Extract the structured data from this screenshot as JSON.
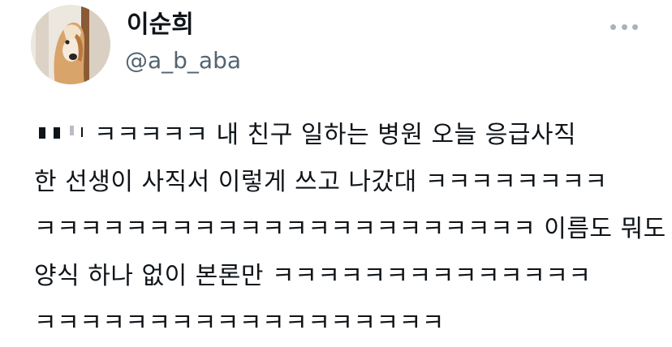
{
  "tweet": {
    "author": {
      "name": "이순희",
      "handle": "@a_b_aba"
    },
    "more_icon": "more-horizontal-icon",
    "body_lines": [
      "ㅋㅋㅋㅋㅋ 내 친구 일하는 병원 오늘 응급사직",
      "한 선생이 사직서 이렇게 쓰고 나갔대 ㅋㅋㅋㅋㅋㅋㅋㅋ",
      "ㅋㅋㅋㅋㅋㅋㅋㅋㅋㅋㅋㅋㅋㅋㅋㅋㅋㅋㅋㅋㅋㅋ 이름도 뭐도",
      "양식 하나 없이 본론만 ㅋㅋㅋㅋㅋㅋㅋㅋㅋㅋㅋㅋㅋㅋ",
      "ㅋㅋㅋㅋㅋㅋㅋㅋㅋㅋㅋㅋㅋㅋㅋㅋㅋㅋ"
    ]
  },
  "colors": {
    "text": "#0f1419",
    "secondary_text": "#536471",
    "more_dots": "#a7b3bc",
    "background": "#ffffff"
  }
}
